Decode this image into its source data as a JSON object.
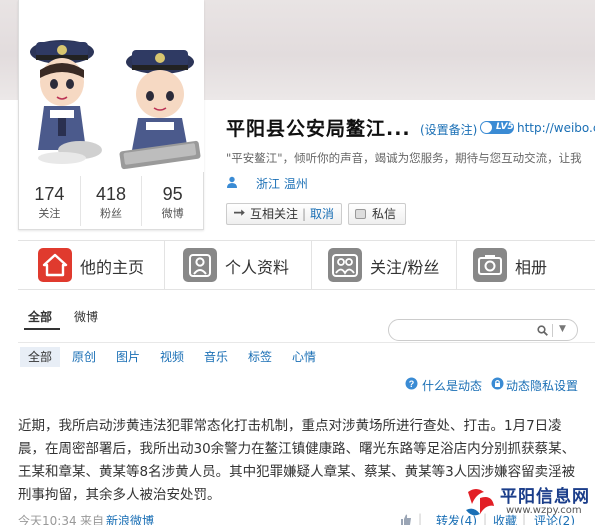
{
  "profile": {
    "name": "平阳县公安局鳌江...",
    "remark_link": "(设置备注)",
    "vip_badge": "LV5",
    "url": "http://weibo.co",
    "description": "\"平安鳌江\"，倾听你的声音，竭诚为您服务，期待与您互动交流，让我",
    "location": "浙江 温州",
    "avatar_alt": "police cartoon avatar",
    "stats": [
      {
        "value": "174",
        "label": "关注"
      },
      {
        "value": "418",
        "label": "粉丝"
      },
      {
        "value": "95",
        "label": "微博"
      }
    ],
    "buttons": {
      "mutual_follow": "互相关注",
      "separator": "|",
      "cancel": "取消",
      "message": "私信"
    }
  },
  "tabs": [
    {
      "label": "他的主页",
      "icon": "home-icon",
      "active": true
    },
    {
      "label": "个人资料",
      "icon": "person-icon",
      "active": false
    },
    {
      "label": "关注/粉丝",
      "icon": "people-icon",
      "active": false
    },
    {
      "label": "相册",
      "icon": "camera-icon",
      "active": false
    }
  ],
  "feed": {
    "type_tabs": [
      "全部",
      "微博"
    ],
    "search_placeholder": "",
    "filters": [
      "全部",
      "原创",
      "图片",
      "视频",
      "音乐",
      "标签",
      "心情"
    ],
    "help_what": "什么是动态",
    "help_privacy": "动态隐私设置"
  },
  "post": {
    "text": "近期，我所启动涉黄违法犯罪常态化打击机制，重点对涉黄场所进行查处、打击。1月7日凌晨，在周密部署后，我所出动30余警力在鳌江镇健康路、曙光东路等足浴店内分别抓获蔡某、王某和章某、黄某等8名涉黄人员。其中犯罪嫌疑人章某、蔡某、黄某等3人因涉嫌容留卖淫被刑事拘留，其余多人被治安处罚。",
    "time": "今天10:34",
    "source_prefix": "来自",
    "source": "新浪微博",
    "repost": "转发(4)",
    "separator": "|",
    "favorite": "收藏",
    "comment": "评论(2)"
  },
  "watermark": {
    "text": "平阳信息网",
    "url": "www.wzpy.com"
  },
  "colors": {
    "link": "#1a6fb5",
    "home_red": "#e03a2e",
    "tab_icon_gray": "#888888",
    "vip_blue": "#3a8bd4"
  }
}
